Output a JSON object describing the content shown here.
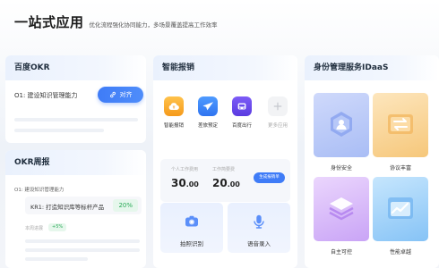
{
  "header": {
    "title": "一站式应用",
    "subtitle": "优化流程强化协同能力，多场景覆盖提高工作效率"
  },
  "okr": {
    "title": "百度OKR",
    "objective": "O1: 建设知识管理能力",
    "align_label": "对齐"
  },
  "weekly": {
    "title": "OKR周报",
    "objective": "O1: 建设知识管理能力",
    "kr_label": "KR1: 打造知识库等标杆产品",
    "kr_percent": "20%",
    "progress_label": "本周进展",
    "progress_delta": "+5%"
  },
  "expense": {
    "title": "智能报销",
    "apps": [
      {
        "label": "智能报销",
        "icon": "cloud-icon",
        "color": "#f5a623"
      },
      {
        "label": "差旅预定",
        "icon": "airplane-icon",
        "color": "#3f8af7"
      },
      {
        "label": "百度出行",
        "icon": "car-icon",
        "color": "#6a4cf0"
      },
      {
        "label": "更多应用",
        "icon": "plus-icon",
        "color": "#f2f3f5"
      }
    ],
    "stats": {
      "personal_label": "个人工作费用",
      "personal_value": "30",
      "personal_decimal": ".00",
      "department_label": "工作简要费",
      "department_value": "20",
      "department_decimal": ".00",
      "generate_label": "生成报销单"
    },
    "tools": [
      {
        "label": "拍照识别",
        "icon": "camera-icon"
      },
      {
        "label": "语音录入",
        "icon": "microphone-icon"
      }
    ]
  },
  "idaas": {
    "title": "身份管理服务IDaaS",
    "tiles": [
      {
        "label": "身份安全",
        "icon": "shield-user-icon"
      },
      {
        "label": "协议丰富",
        "icon": "exchange-icon"
      },
      {
        "label": "自主可控",
        "icon": "stack-icon"
      },
      {
        "label": "性能卓越",
        "icon": "chart-window-icon"
      }
    ]
  }
}
